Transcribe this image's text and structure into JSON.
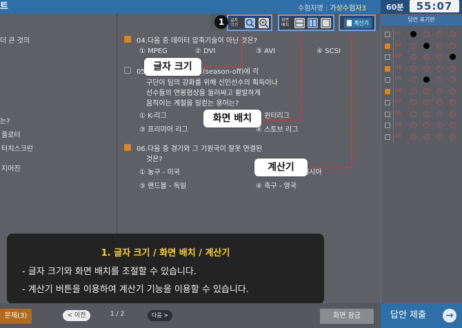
{
  "header": {
    "brand": "트",
    "examinee_label": "수험자명 : ",
    "examinee_name": "가상수험자3",
    "time_limit": "60분",
    "timer": "55:07"
  },
  "toolbar": {
    "font_size_label_line1": "글자",
    "font_size_label_line2": "크기",
    "layout_label_line1": "화면",
    "layout_label_line2": "배치",
    "calculator_label": "계산기"
  },
  "left_panel": {
    "lines": [
      "더 큰 것의",
      "는?",
      "플로터",
      "터치스크린",
      "지어진"
    ]
  },
  "questions": [
    {
      "text_lines": [
        "04.다음 중 데이터 압축기술이 아닌 것은?"
      ],
      "options": [
        "① MPEG",
        "② DVI",
        "③ AVI",
        "④ SCSI"
      ]
    },
    {
      "text_lines": [
        "05.다음 중 스토브리그(season-off)에 각",
        "구단이 팀의 강화를 위해 신인선수의 획득이나",
        "선수들의 연봉협상을 둘러싸고 활발하게",
        "움직이는 계절을 일컫는 용어는?"
      ],
      "options": [
        "① K-리그",
        "② 윈터리그",
        "③ 프리미어 리그",
        "④ 스토브 리그"
      ]
    },
    {
      "text_lines": [
        "06.다음 중 경기와 그 기원국이 잘못 연결된",
        "것은?"
      ],
      "options": [
        "① 농구 - 미국",
        "② 크리켓 - 인도네시아",
        "③ 핸드볼 - 독일",
        "④ 축구 - 영국"
      ]
    }
  ],
  "answer_sheet": {
    "title": "답안 표기란",
    "rows": [
      {
        "num": "01",
        "checked": false,
        "filled": 1
      },
      {
        "num": "02",
        "checked": true,
        "filled": 2
      },
      {
        "num": "03",
        "checked": false,
        "filled": 4
      },
      {
        "num": "04",
        "checked": true,
        "filled": 0
      },
      {
        "num": "05",
        "checked": false,
        "filled": 2
      },
      {
        "num": "06",
        "checked": true,
        "filled": 0
      },
      {
        "num": "07",
        "checked": false,
        "filled": 0
      },
      {
        "num": "08",
        "checked": false,
        "filled": 0
      },
      {
        "num": "09",
        "checked": false,
        "filled": 0
      },
      {
        "num": "10",
        "checked": false,
        "filled": 0
      }
    ],
    "bubble_labels": [
      "①",
      "②",
      "③",
      "④"
    ]
  },
  "footer": {
    "problems_button": "문제(3)",
    "prev_button": "< 이전",
    "page": "1 / 2",
    "next_button": "다음 >",
    "screen_lock_button": "화면 잠금",
    "submit_button": "답안 제출",
    "submit_arrow": "→"
  },
  "callouts": {
    "badge": "1",
    "font_size": "글자 크기",
    "layout": "화면 배치",
    "calculator": "계산기"
  },
  "info": {
    "title": "1. 글자 크기 / 화면 배치 / 계산기",
    "line1": "- 글자 크기와 화면 배치를 조절할 수 있습니다.",
    "line2": "- 계산기 버튼을 이용하여 계산기 기능을 이용할 수 있습니다."
  },
  "colors": {
    "accent_blue": "#2f6fa8",
    "callout_line": "#ff2a2a",
    "info_title": "#ffd21f",
    "checked_orange": "#d9861f"
  }
}
